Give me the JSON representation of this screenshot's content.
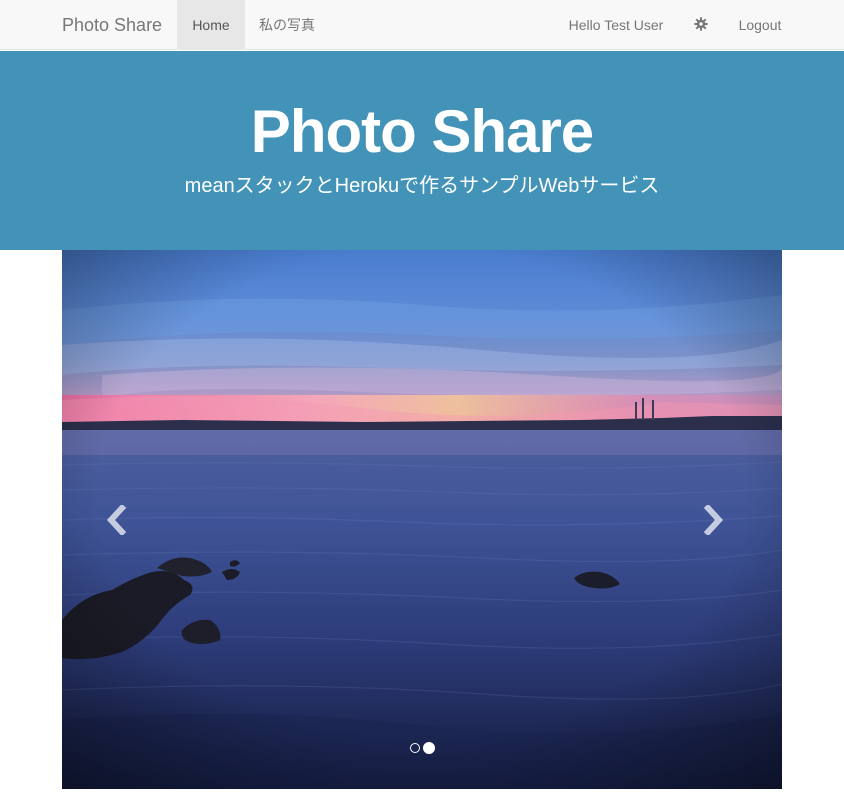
{
  "navbar": {
    "brand": "Photo Share",
    "items": [
      {
        "label": "Home",
        "active": true
      },
      {
        "label": "私の写真",
        "active": false
      }
    ],
    "greeting": "Hello Test User",
    "settings_icon": "gear-icon",
    "logout_label": "Logout"
  },
  "hero": {
    "title": "Photo Share",
    "subtitle": "meanスタックとHerokuで作るサンプルWebサービス",
    "background": "#4393b9"
  },
  "carousel": {
    "prev_icon": "chevron-left-icon",
    "next_icon": "chevron-right-icon",
    "slide_count": 2,
    "active_index": 1
  }
}
